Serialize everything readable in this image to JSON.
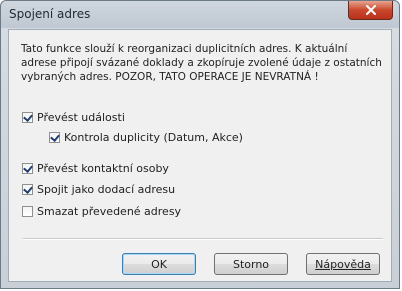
{
  "window": {
    "title": "Spojení adres"
  },
  "description": "Tato funkce slouží k reorganizaci duplicitních adres. K aktuální adrese připojí svázané doklady a zkopíruje zvolené údaje z ostatních vybraných adres. POZOR, TATO OPERACE JE NEVRATNÁ !",
  "options": {
    "prevest_udalosti": {
      "label": "Převést události",
      "checked": true
    },
    "kontrola_duplicity": {
      "label": "Kontrola duplicity (Datum, Akce)",
      "checked": true
    },
    "prevest_kontaktni_osoby": {
      "label": "Převést kontaktní osoby",
      "checked": true
    },
    "spojit_dodaci": {
      "label": "Spojit jako dodací adresu",
      "checked": true
    },
    "smazat_prevedene": {
      "label": "Smazat převedené adresy",
      "checked": false
    }
  },
  "buttons": {
    "ok": "OK",
    "storno": "Storno",
    "help": "Nápověda"
  }
}
